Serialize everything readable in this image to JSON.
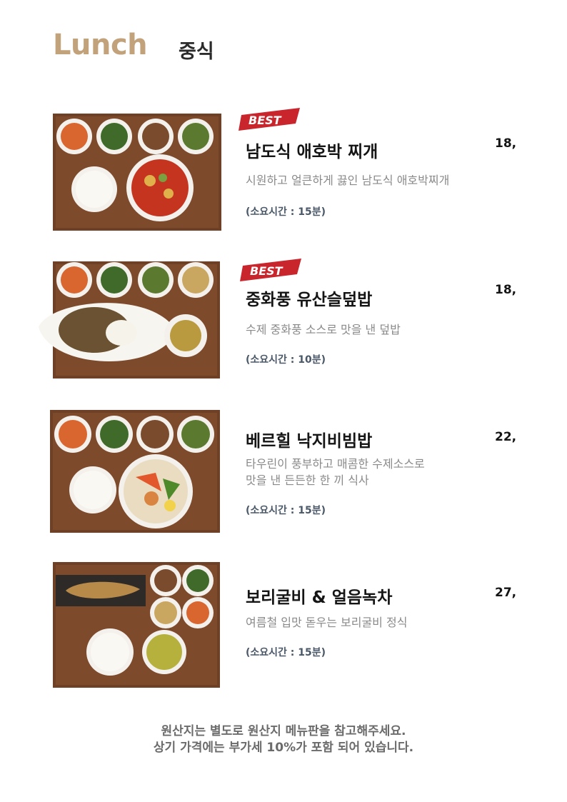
{
  "header": {
    "title_en": "Lunch",
    "title_ko": "중식"
  },
  "best_badge": "BEST",
  "items": [
    {
      "name": "남도식 애호박 찌개",
      "price": "18,",
      "description": "시원하고 얼큰하게 끓인 남도식 애호박찌개",
      "time": "(소요시간 : 15분)",
      "best": true
    },
    {
      "name": "중화풍 유산슬덮밥",
      "price": "18,",
      "description": "수제 중화풍 소스로 맛을 낸 덮밥",
      "time": "(소요시간 : 10분)",
      "best": true
    },
    {
      "name": "베르힐 낙지비빔밥",
      "price": "22,",
      "description": "타우린이 풍부하고 매콤한 수제소스로\n맛을 낸 든든한 한 끼 식사",
      "time": "(소요시간 : 15분)",
      "best": false
    },
    {
      "name": "보리굴비 & 얼음녹차",
      "price": "27,",
      "description": "여름철 입맛 돋우는 보리굴비 정식",
      "time": "(소요시간 : 15분)",
      "best": false
    }
  ],
  "footer": {
    "line1": "원산지는 별도로 원산지 메뉴판을 참고해주세요.",
    "line2": "상기 가격에는 부가세 10%가 포함 되어 있습니다."
  },
  "colors": {
    "accent": "#c2a27a",
    "tray": "#6b3f25",
    "badge": "#c8252c",
    "time_text": "#4a5868"
  }
}
